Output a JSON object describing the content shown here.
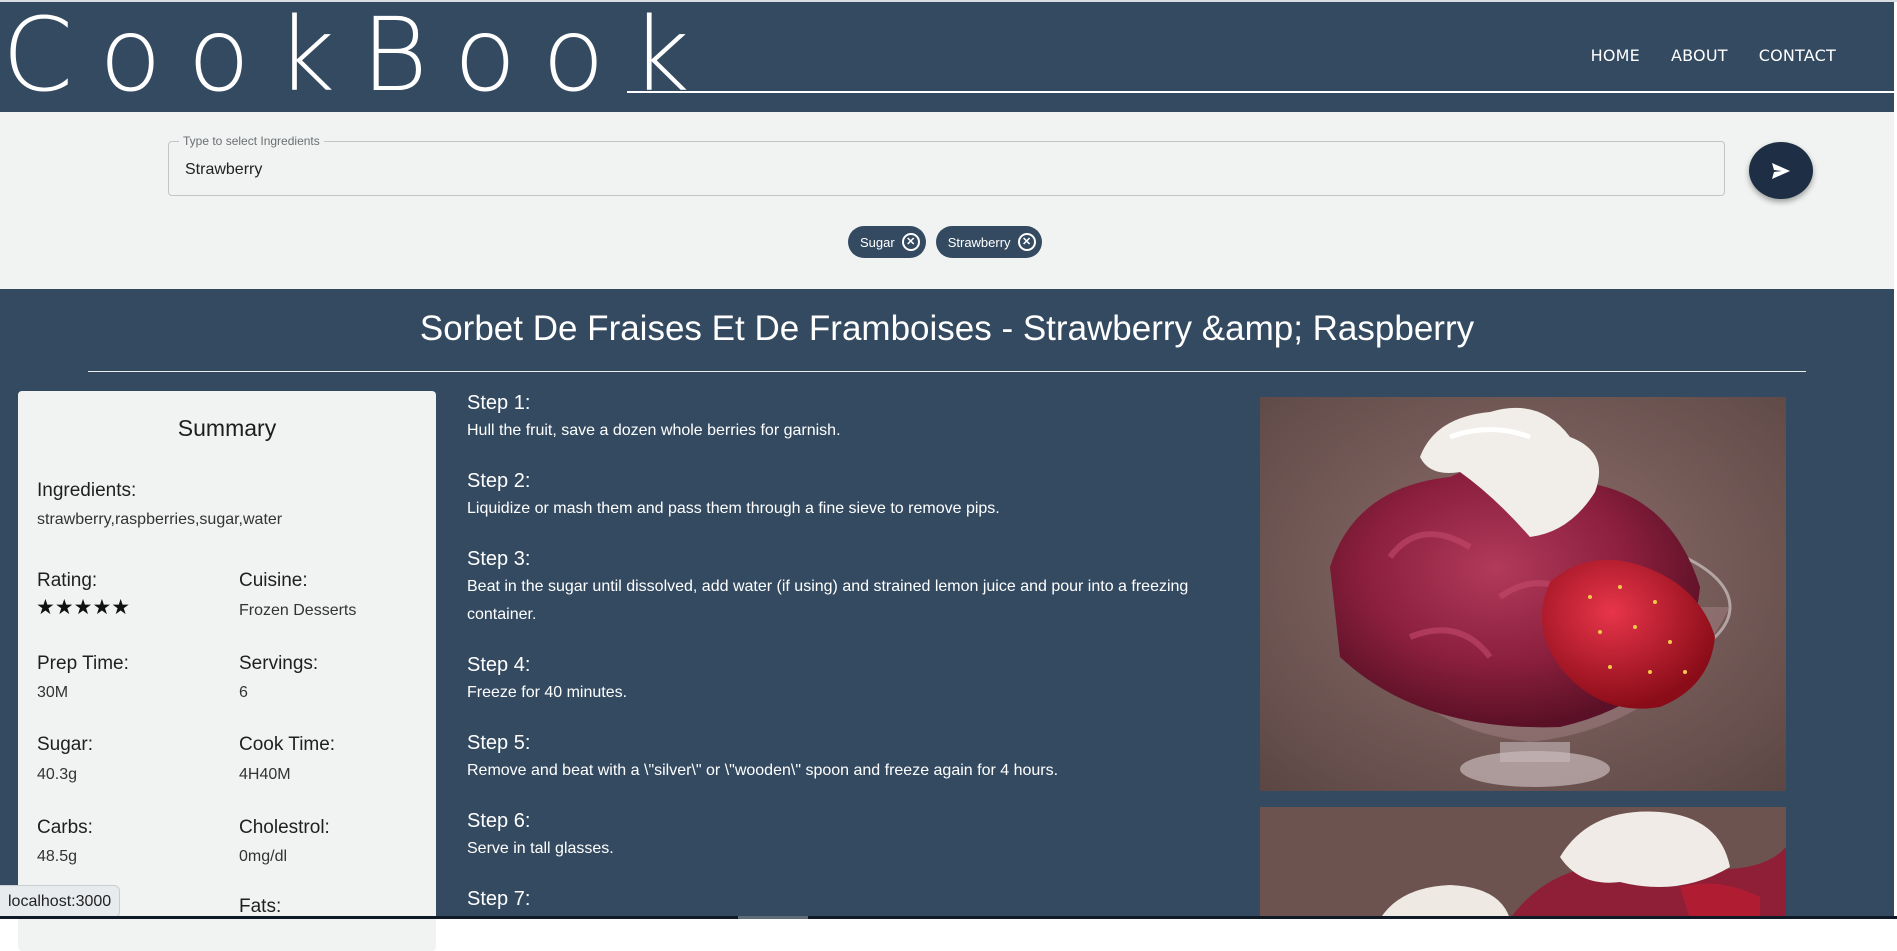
{
  "header": {
    "logo": "CookBook",
    "nav": [
      "HOME",
      "ABOUT",
      "CONTACT"
    ]
  },
  "search": {
    "legend": "Type to select Ingredients",
    "value": "Strawberry",
    "chips": [
      "Sugar",
      "Strawberry"
    ],
    "send_icon": "send-icon"
  },
  "recipe": {
    "title": "Sorbet De Fraises Et De Framboises - Strawberry &amp; Raspberry",
    "summary": {
      "heading": "Summary",
      "ingredients_label": "Ingredients:",
      "ingredients": "strawberry,raspberries,sugar,water",
      "rating_label": "Rating:",
      "rating_stars": "★★★★★",
      "rating_value": 5,
      "cuisine_label": "Cuisine:",
      "cuisine": "Frozen Desserts",
      "prep_label": "Prep Time:",
      "prep": "30M",
      "servings_label": "Servings:",
      "servings": "6",
      "sugar_label": "Sugar:",
      "sugar": "40.3g",
      "cook_label": "Cook Time:",
      "cook": "4H40M",
      "carbs_label": "Carbs:",
      "carbs": "48.5g",
      "cholesterol_label": "Cholestrol:",
      "cholesterol": "0mg/dl",
      "fats_label": "Fats:"
    },
    "steps": [
      {
        "label": "Step 1:",
        "text": "Hull the fruit, save a dozen whole berries for garnish."
      },
      {
        "label": "Step 2:",
        "text": "Liquidize or mash them and pass them through a fine sieve to remove pips."
      },
      {
        "label": "Step 3:",
        "text": "Beat in the sugar until dissolved, add water (if using) and strained lemon juice and pour into a freezing container."
      },
      {
        "label": "Step 4:",
        "text": "Freeze for 40 minutes."
      },
      {
        "label": "Step 5:",
        "text": "Remove and beat with a \\\"silver\\\" or \\\"wooden\\\" spoon and freeze again for 4 hours."
      },
      {
        "label": "Step 6:",
        "text": "Serve in tall glasses."
      },
      {
        "label": "Step 7:",
        "text": ""
      }
    ]
  },
  "status": {
    "url": "localhost:3000"
  },
  "colors": {
    "header_bg": "#344a61",
    "band_bg": "#f1f3f2",
    "send_button": "#1e2f45",
    "chip_bg": "#344a61"
  }
}
